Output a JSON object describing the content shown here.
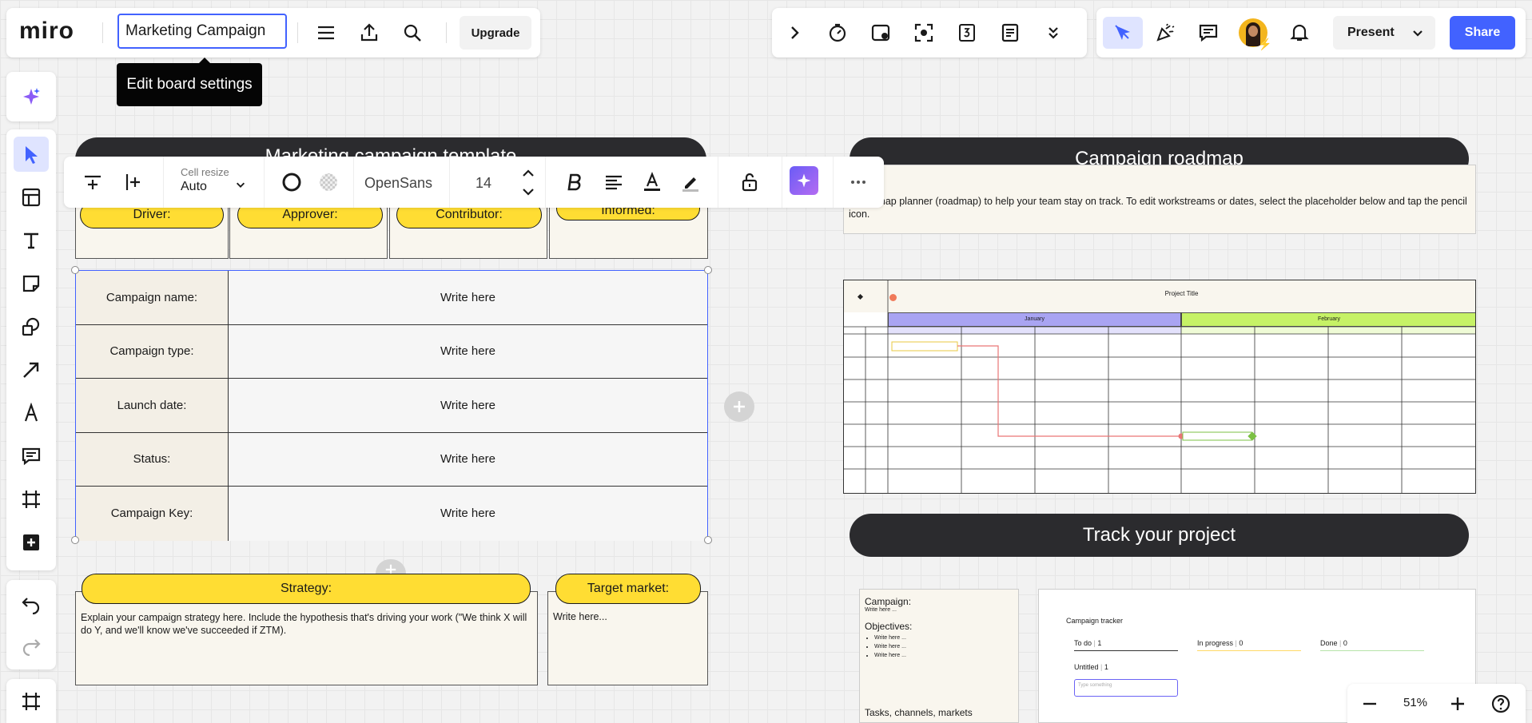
{
  "topbar": {
    "logo": "miro",
    "board_name": "Marketing Campaign",
    "upgrade_label": "Upgrade",
    "tooltip": "Edit board settings",
    "present_label": "Present",
    "share_label": "Share",
    "colors": {
      "share": "#4262ff",
      "accent": "#4262ff"
    }
  },
  "format_toolbar": {
    "cell_resize_label": "Cell resize",
    "cell_resize_value": "Auto",
    "font_name": "OpenSans",
    "font_size": "14"
  },
  "left_board": {
    "title_partial": "Marketing campaign template",
    "roles": [
      "Driver:",
      "Approver:",
      "Contributor:",
      "Informed:"
    ],
    "rows": [
      {
        "label": "Campaign name:",
        "value": "Write here"
      },
      {
        "label": "Campaign type:",
        "value": "Write here"
      },
      {
        "label": "Launch date:",
        "value": "Write here"
      },
      {
        "label": "Status:",
        "value": "Write here"
      },
      {
        "label": "Campaign Key:",
        "value": "Write here"
      }
    ],
    "strategy_label": "Strategy:",
    "strategy_text": "Explain your campaign strategy here. Include the hypothesis that's driving your work (\"We think X will do Y, and we'll know we've succeeded if ZTM).",
    "target_label": "Target market:",
    "target_text": "Write here..."
  },
  "right_board": {
    "roadmap_title": "Campaign roadmap",
    "roadmap_desc": "...roadmap planner (roadmap) to help your team stay on track. To edit workstreams or dates, select the placeholder below and tap the pencil icon.",
    "project_title": "Project Title",
    "month_1": "January",
    "month_2": "February",
    "track_title": "Track your project",
    "campaign_card": {
      "campaign_label": "Campaign:",
      "campaign_value": "Write here ...",
      "objectives_label": "Objectives:",
      "objectives": [
        "Write here ...",
        "Write here ...",
        "Write here ..."
      ],
      "tasks_label": "Tasks, channels, markets"
    },
    "tracker": {
      "title": "Campaign tracker",
      "cols": [
        {
          "name": "To do",
          "count": "1"
        },
        {
          "name": "In progress",
          "count": "0"
        },
        {
          "name": "Done",
          "count": "0"
        }
      ],
      "item_label": "Untitled",
      "item_count": "1",
      "input_placeholder": "Type something"
    }
  },
  "zoom": {
    "value": "51%"
  }
}
